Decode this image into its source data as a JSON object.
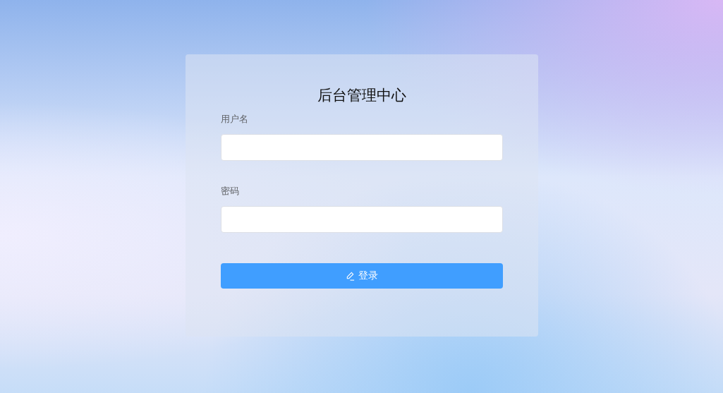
{
  "title": "后台管理中心",
  "fields": [
    {
      "label": "用户名"
    },
    {
      "label": "密码"
    }
  ],
  "button": {
    "label": "登录"
  }
}
